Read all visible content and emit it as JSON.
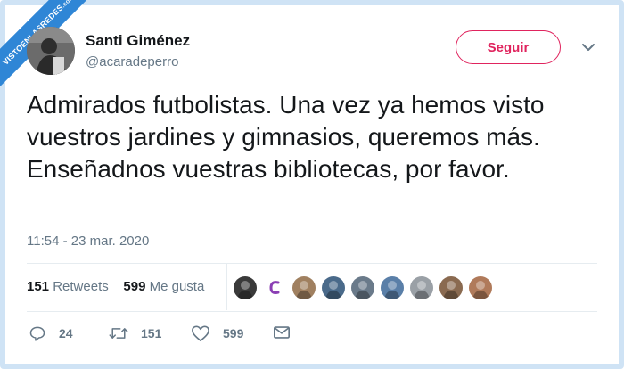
{
  "watermark": {
    "text": "VISTOENLASREDES",
    "suffix": ".com"
  },
  "author": {
    "name": "Santi Giménez",
    "handle": "@acaradeperro",
    "avatar_icon": "user-avatar"
  },
  "follow_button": {
    "label": "Seguir",
    "color": "#e0245e"
  },
  "menu_icon": "chevron-down-icon",
  "tweet": {
    "text": "Admirados futbolistas. Una vez ya hemos visto vuestros jardines y gimnasios, queremos más. Enseñadnos vuestras bibliotecas, por favor.",
    "timestamp": "11:54 - 23 mar. 2020"
  },
  "stats": {
    "retweets_count": "151",
    "retweets_label": "Retweets",
    "likes_count": "599",
    "likes_label": "Me gusta"
  },
  "likers": [
    {
      "name": "liker-avatar-1",
      "color": "#3a3a3a"
    },
    {
      "name": "liker-avatar-2",
      "color": "#8b3fb4"
    },
    {
      "name": "liker-avatar-3",
      "color": "#a08060"
    },
    {
      "name": "liker-avatar-4",
      "color": "#4a6a8a"
    },
    {
      "name": "liker-avatar-5",
      "color": "#6a7a8a"
    },
    {
      "name": "liker-avatar-6",
      "color": "#5a7fa8"
    },
    {
      "name": "liker-avatar-7",
      "color": "#9aa0a6"
    },
    {
      "name": "liker-avatar-8",
      "color": "#8a6a50"
    },
    {
      "name": "liker-avatar-9",
      "color": "#b07a5a"
    }
  ],
  "actions": {
    "reply": {
      "icon": "reply-icon",
      "count": "24"
    },
    "retweet": {
      "icon": "retweet-icon",
      "count": "151"
    },
    "like": {
      "icon": "heart-icon",
      "count": "599"
    },
    "message": {
      "icon": "message-icon"
    }
  },
  "colors": {
    "text": "#14171a",
    "secondary": "#657786",
    "border": "#cfe3f5",
    "divider": "#e6ecf0"
  }
}
